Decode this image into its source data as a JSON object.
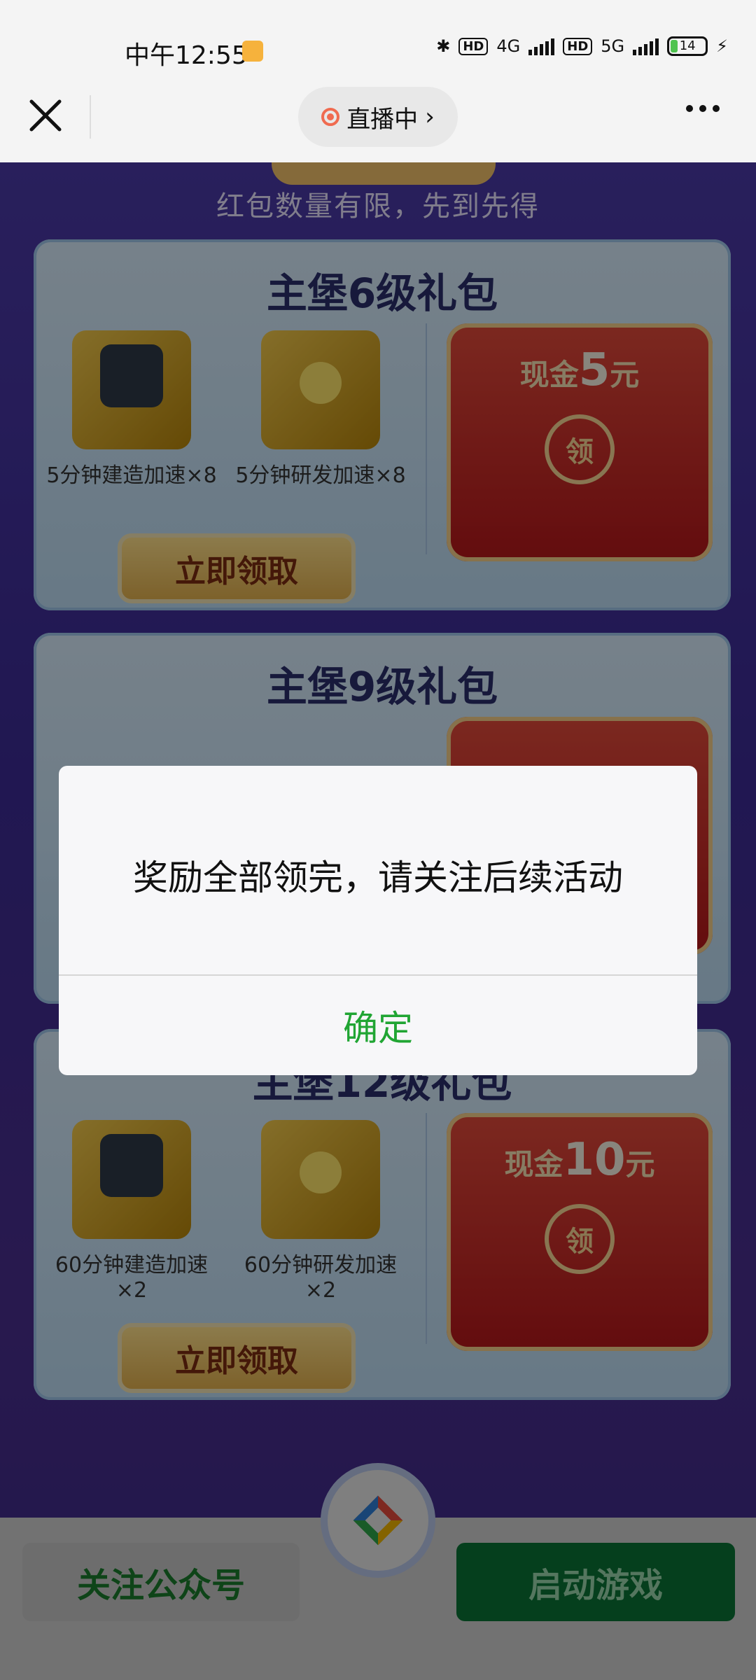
{
  "status_bar": {
    "time": "中午12:55",
    "network_left": "4G",
    "network_right": "5G",
    "battery": "14"
  },
  "nav": {
    "live_label": "直播中",
    "close_icon": "close-icon",
    "more_icon": "more-icon",
    "chevron_icon": "chevron-right-icon"
  },
  "page": {
    "limit_text": "红包数量有限，先到先得",
    "cards": [
      {
        "title": "主堡6级礼包",
        "items": [
          "5分钟建造加速×8",
          "5分钟研发加速×8"
        ],
        "cash_prefix": "现金",
        "cash_amount": "5",
        "cash_suffix": "元",
        "seal": "领",
        "button": "立即领取"
      },
      {
        "title": "主堡9级礼包"
      },
      {
        "title": "主堡12级礼包",
        "items": [
          "60分钟建造加速×2",
          "60分钟研发加速×2"
        ],
        "cash_prefix": "现金",
        "cash_amount": "10",
        "cash_suffix": "元",
        "seal": "领",
        "button": "立即领取"
      }
    ]
  },
  "dialog": {
    "message": "奖励全部领完，请关注后续活动",
    "ok_label": "确定"
  },
  "bottom": {
    "follow_label": "关注公众号",
    "launch_label": "启动游戏"
  },
  "colors": {
    "accent_green": "#20a533",
    "launch_bg": "#0a7335"
  }
}
